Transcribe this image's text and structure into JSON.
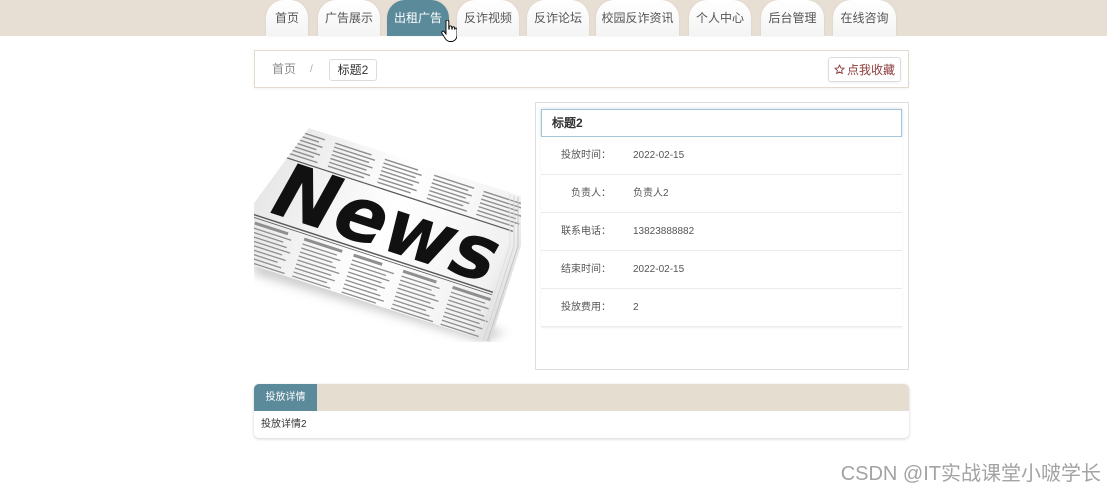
{
  "nav": {
    "tabs": [
      {
        "label": "首页",
        "active": false
      },
      {
        "label": "广告展示",
        "active": false
      },
      {
        "label": "出租广告",
        "active": true
      },
      {
        "label": "反诈视频",
        "active": false
      },
      {
        "label": "反诈论坛",
        "active": false
      },
      {
        "label": "校园反诈资讯",
        "active": false
      },
      {
        "label": "个人中心",
        "active": false
      },
      {
        "label": "后台管理",
        "active": false
      },
      {
        "label": "在线咨询",
        "active": false
      }
    ],
    "cursor_icon": "hand-cursor-icon"
  },
  "breadcrumb": {
    "home": "首页",
    "separator": "/",
    "current": "标题2"
  },
  "favorite_button": {
    "icon": "star-outline-icon",
    "label": "点我收藏"
  },
  "image": {
    "headline": "News"
  },
  "detail": {
    "title": "标题2",
    "rows": [
      {
        "label": "投放时间：",
        "value": "2022-02-15"
      },
      {
        "label": "负责人：",
        "value": "负责人2"
      },
      {
        "label": "联系电话：",
        "value": "13823888882"
      },
      {
        "label": "结束时间：",
        "value": "2022-02-15"
      },
      {
        "label": "投放费用：",
        "value": "2"
      }
    ]
  },
  "details_tab": {
    "label": "投放详情",
    "content": "投放详情2"
  },
  "watermark": "CSDN @IT实战课堂小啵学长",
  "colors": {
    "accent": "#5b8a9a",
    "nav_bg": "#e7dfd3",
    "tab_header_bg": "#e6ddd1",
    "favorite": "#8e3b3b"
  }
}
